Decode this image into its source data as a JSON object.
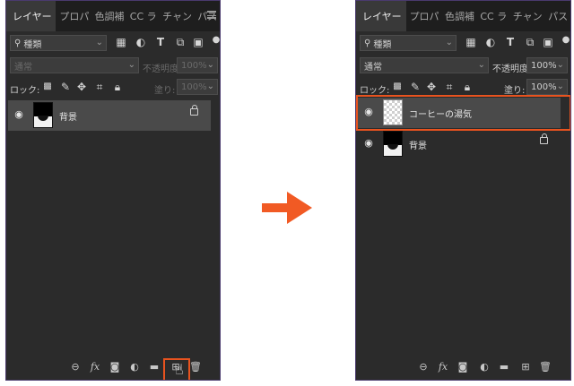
{
  "colors": {
    "panel_bg": "#2b2b2b",
    "tab_bg": "#1e1e1e",
    "highlight": "#e8531f",
    "arrow": "#f15a24"
  },
  "before": {
    "tabs": [
      "レイヤー",
      "プロパ",
      "色調補",
      "CC ラ",
      "チャン",
      "パス"
    ],
    "filter": {
      "value": "種類"
    },
    "blend_mode": "通常",
    "opacity_label": "不透明度:",
    "opacity_value": "100%",
    "lock_label": "ロック:",
    "fill_label": "塗り:",
    "fill_value": "100%",
    "layers": [
      {
        "name": "背景",
        "thumbnail": "photo",
        "locked": true,
        "selected": true
      }
    ],
    "bottom_icons": [
      "link-icon",
      "fx-icon",
      "mask-icon",
      "adjustment-icon",
      "folder-icon",
      "new-layer-icon",
      "trash-icon"
    ],
    "fx_label": "fx",
    "highlighted": "new-layer-button"
  },
  "after": {
    "tabs": [
      "レイヤー",
      "プロパ",
      "色調補",
      "CC ラ",
      "チャン",
      "パス"
    ],
    "filter": {
      "value": "種類"
    },
    "blend_mode": "通常",
    "opacity_label": "不透明度:",
    "opacity_value": "100%",
    "lock_label": "ロック:",
    "fill_label": "塗り:",
    "fill_value": "100%",
    "layers": [
      {
        "name": "コーヒーの湯気",
        "thumbnail": "transparent",
        "locked": false,
        "selected": true
      },
      {
        "name": "背景",
        "thumbnail": "photo",
        "locked": true,
        "selected": false
      }
    ],
    "bottom_icons": [
      "link-icon",
      "fx-icon",
      "mask-icon",
      "adjustment-icon",
      "folder-icon",
      "new-layer-icon",
      "trash-icon"
    ],
    "fx_label": "fx",
    "highlighted": "new-layer-row"
  }
}
